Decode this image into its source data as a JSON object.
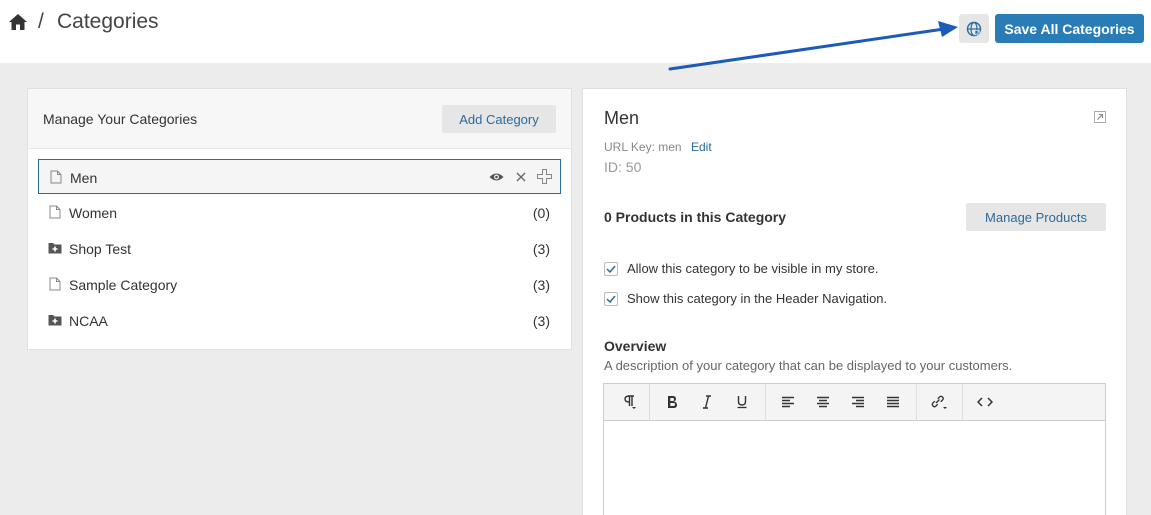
{
  "header": {
    "separator": "/",
    "title": "Categories",
    "save_label": "Save All Categories",
    "home_icon": "home-icon",
    "globe_icon": "globe-icon"
  },
  "left_panel": {
    "title": "Manage Your Categories",
    "add_label": "Add Category",
    "categories": [
      {
        "name": "Men",
        "count": "",
        "icon": "page-icon",
        "selected": true
      },
      {
        "name": "Women",
        "count": "(0)",
        "icon": "page-icon"
      },
      {
        "name": "Shop Test",
        "count": "(3)",
        "icon": "folder-plus-icon"
      },
      {
        "name": "Sample Category",
        "count": "(3)",
        "icon": "page-icon"
      },
      {
        "name": "NCAA",
        "count": "(3)",
        "icon": "folder-plus-icon"
      }
    ]
  },
  "detail": {
    "title": "Men",
    "url_key": "URL Key: men",
    "edit_label": "Edit",
    "id_line": "ID: 50",
    "products_count": "0 Products in this Category",
    "manage_label": "Manage Products",
    "checks": [
      {
        "label": "Allow this category to be visible in my store.",
        "checked": true
      },
      {
        "label": "Show this category in the Header Navigation.",
        "checked": true
      }
    ],
    "overview_title": "Overview",
    "overview_desc": "A description of your category that can be displayed to your customers."
  },
  "colors": {
    "primary": "#2a7cb6",
    "link": "#2a6b9c",
    "arrow": "#1e5bb8"
  }
}
